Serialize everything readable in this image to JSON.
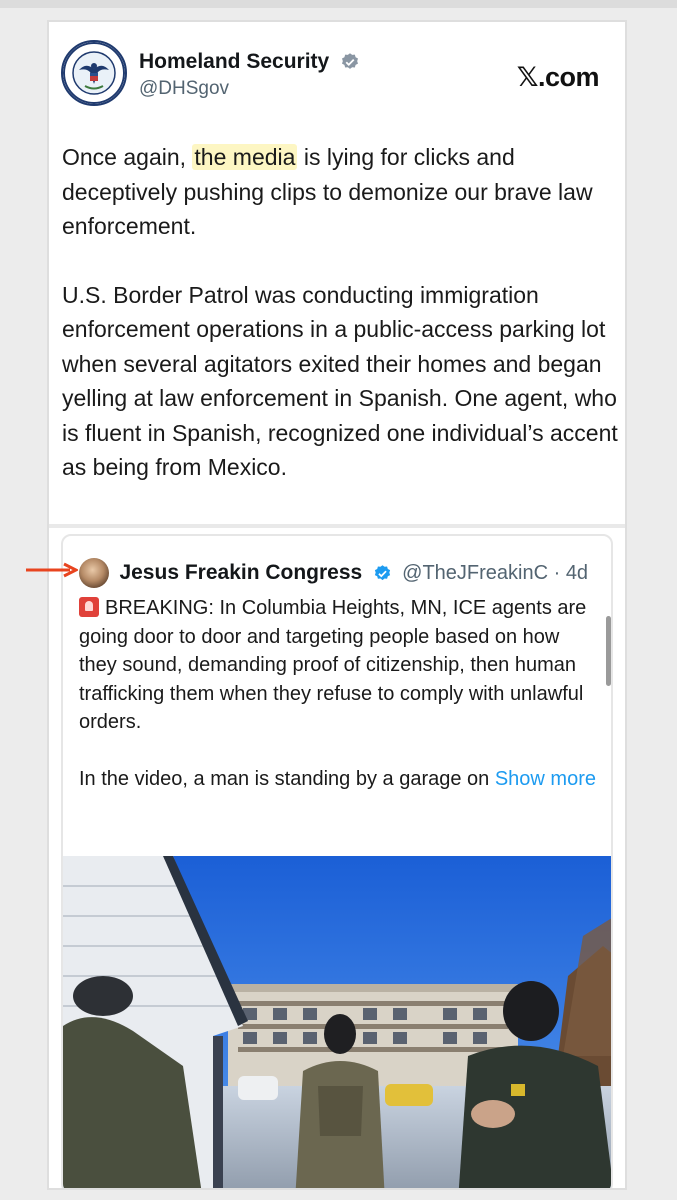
{
  "post": {
    "author_name": "Homeland Security",
    "author_handle": "@DHSgov",
    "site": "𝕏.com",
    "text_p1_pre": "Once again, ",
    "text_p1_highlight": "the media",
    "text_p1_post": " is lying for clicks and deceptively pushing clips to demonize our brave law enforcement.",
    "text_p2": "U.S. Border Patrol was conducting immigration enforcement operations in a public-access parking lot when several agitators exited their homes and began yelling at law enforcement in Spanish. One agent, who is fluent in Spanish, recognized one individual’s accent as being from Mexico."
  },
  "quoted": {
    "author_name": "Jesus Freakin Congress",
    "author_handle": "@TheJFreakinC · 4d",
    "text_p1": "BREAKING: In Columbia Heights, MN, ICE agents are going door to door and targeting people based on how they sound, demanding proof of citizenship, then human trafficking them when they refuse to comply with unlawful orders.",
    "text_p2": "In the video, a man is standing by a garage on ",
    "show_more": "Show more"
  },
  "icons": {
    "verified": "verified-badge-icon",
    "siren": "siren-emoji-icon",
    "arrow": "red-arrow-icon"
  },
  "colors": {
    "link": "#1d9bf0",
    "verified": "#1d9bf0",
    "highlight": "#fdf6c3",
    "arrow": "#e8441f"
  }
}
